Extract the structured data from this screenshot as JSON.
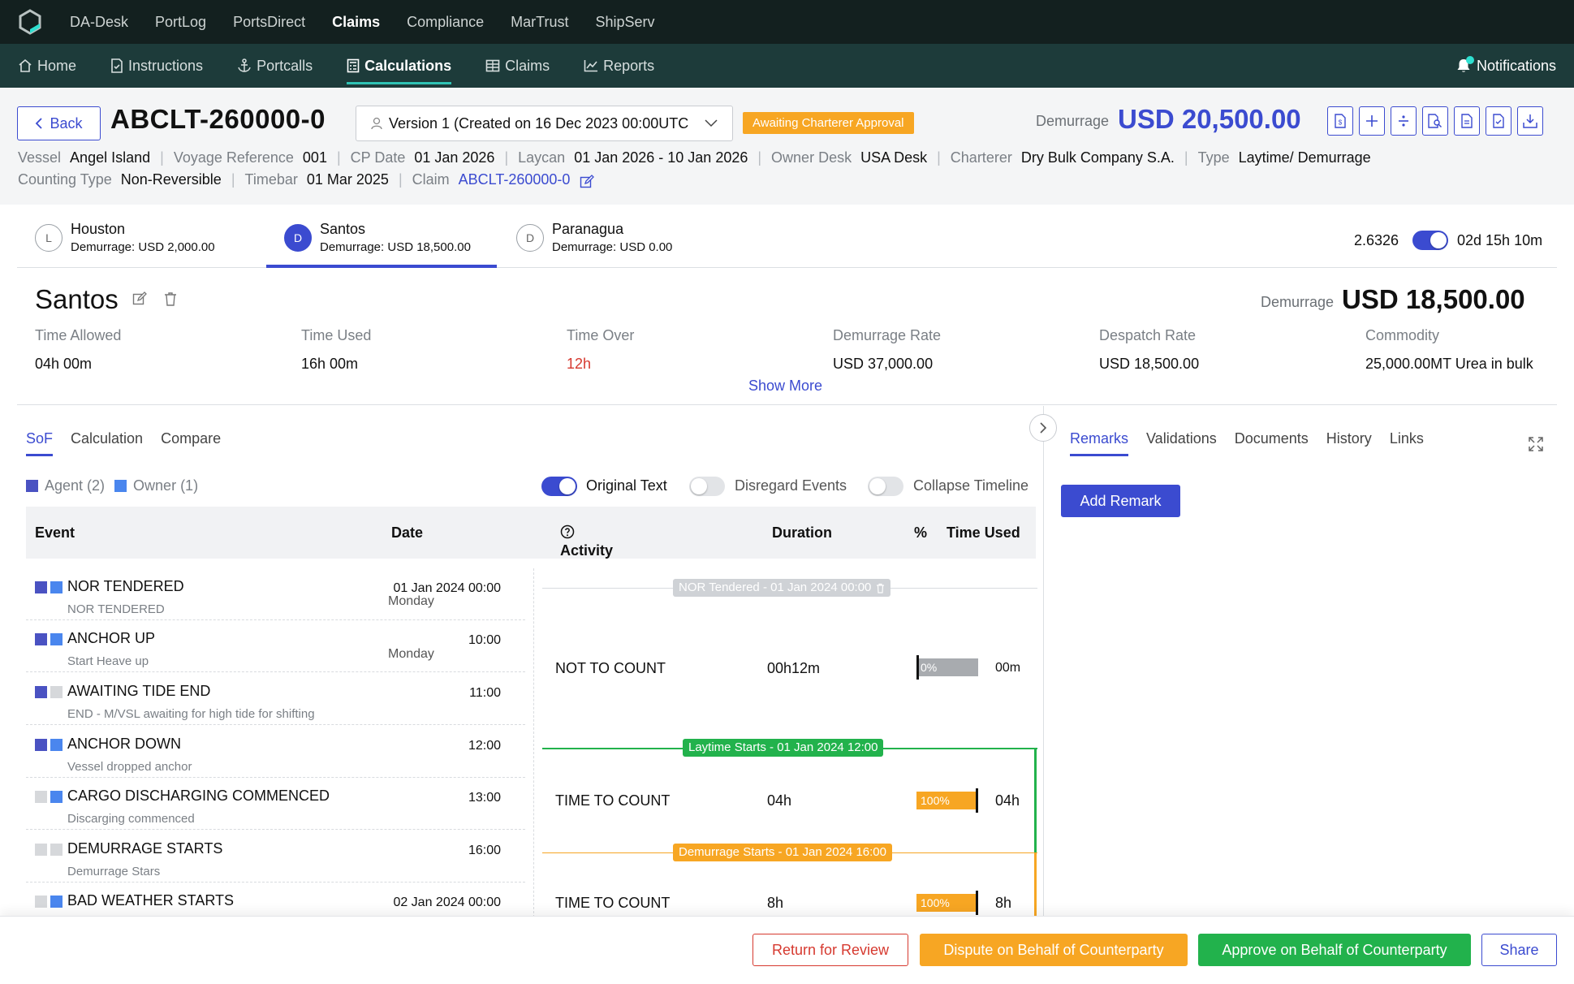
{
  "topnav": [
    "DA-Desk",
    "PortLog",
    "PortsDirect",
    "Claims",
    "Compliance",
    "MarTrust",
    "ShipServ"
  ],
  "topnav_active": "Claims",
  "subnav": {
    "home": "Home",
    "instructions": "Instructions",
    "portcalls": "Portcalls",
    "calculations": "Calculations",
    "claims": "Claims",
    "reports": "Reports",
    "notifications": "Notifications"
  },
  "header": {
    "back": "Back",
    "claim_id": "ABCLT-260000-0",
    "version": "Version 1 (Created on 16 Dec 2023 00:00UTC",
    "status_badge": "Awaiting Charterer Approval",
    "demurrage_label": "Demurrage",
    "demurrage_value": "USD 20,500.00"
  },
  "meta": {
    "vessel_k": "Vessel",
    "vessel_v": "Angel Island",
    "voyage_k": "Voyage Reference",
    "voyage_v": "001",
    "cpdate_k": "CP Date",
    "cpdate_v": "01 Jan 2026",
    "laycan_k": "Laycan",
    "laycan_v": "01 Jan 2026 - 10 Jan 2026",
    "ownerdesk_k": "Owner Desk",
    "ownerdesk_v": "USA Desk",
    "charterer_k": "Charterer",
    "charterer_v": "Dry Bulk Company S.A.",
    "type_k": "Type",
    "type_v": "Laytime/ Demurrage",
    "counting_k": "Counting Type",
    "counting_v": "Non-Reversible",
    "timebar_k": "Timebar",
    "timebar_v": "01 Mar 2025",
    "claim_k": "Claim",
    "claim_v": "ABCLT-260000-0"
  },
  "ports": [
    {
      "letter": "L",
      "name": "Houston",
      "demurrage": "Demurrage: USD 2,000.00"
    },
    {
      "letter": "D",
      "name": "Santos",
      "demurrage": "Demurrage: USD 18,500.00"
    },
    {
      "letter": "D",
      "name": "Paranagua",
      "demurrage": "Demurrage: USD 0.00"
    }
  ],
  "ratio": "2.6326",
  "total_duration": "02d 15h 10m",
  "port": {
    "title": "Santos",
    "demurrage_label": "Demurrage",
    "demurrage_value": "USD 18,500.00",
    "stats": [
      {
        "k": "Time Allowed",
        "v": "04h 00m"
      },
      {
        "k": "Time Used",
        "v": "16h 00m"
      },
      {
        "k": "Time Over",
        "v": "12h"
      },
      {
        "k": "Demurrage Rate",
        "v": "USD 37,000.00"
      },
      {
        "k": "Despatch Rate",
        "v": "USD 18,500.00"
      },
      {
        "k": "Commodity",
        "v": "25,000.00MT Urea in bulk"
      }
    ],
    "show_more": "Show More"
  },
  "left_tabs": [
    "SoF",
    "Calculation",
    "Compare"
  ],
  "legend": {
    "agent": "Agent (2)",
    "owner": "Owner (1)"
  },
  "toggles": {
    "original_text": "Original Text",
    "disregard": "Disregard Events",
    "collapse": "Collapse Timeline"
  },
  "table_head": {
    "event": "Event",
    "date": "Date",
    "activity": "Activity",
    "duration": "Duration",
    "pct": "%",
    "time_used": "Time Used"
  },
  "events": [
    {
      "name": "NOR TENDERED",
      "desc": "NOR TENDERED",
      "time": "01 Jan 2024 00:00",
      "weekday": "Monday",
      "agent": true,
      "owner": true
    },
    {
      "name": "ANCHOR UP",
      "desc": "Start Heave up",
      "time": "10:00",
      "weekday": "Monday",
      "agent": true,
      "owner": true
    },
    {
      "name": "AWAITING TIDE END",
      "desc": "END - M/VSL awaiting for high tide for shifting",
      "time": "11:00",
      "weekday": "",
      "agent": true,
      "owner": false
    },
    {
      "name": "ANCHOR DOWN",
      "desc": "Vessel dropped anchor",
      "time": "12:00",
      "weekday": "",
      "agent": true,
      "owner": true
    },
    {
      "name": "CARGO DISCHARGING COMMENCED",
      "desc": "Discarging commenced",
      "time": "13:00",
      "weekday": "",
      "agent": false,
      "owner": true
    },
    {
      "name": "DEMURRAGE STARTS",
      "desc": "Demurrage Stars",
      "time": "16:00",
      "weekday": "",
      "agent": false,
      "owner": false
    },
    {
      "name": "BAD WEATHER STARTS",
      "desc": "",
      "time": "02 Jan 2024 00:00",
      "weekday": "",
      "agent": false,
      "owner": true
    }
  ],
  "markers": {
    "nor": "NOR Tendered - 01 Jan 2024 00:00",
    "laytime": "Laytime Starts - 01 Jan 2024 12:00",
    "demurrage": "Demurrage Starts - 01 Jan 2024 16:00"
  },
  "activities": [
    {
      "activity": "NOT TO COUNT",
      "duration": "00h12m",
      "pct_label": "0%",
      "pct": 0,
      "time_used": "00m"
    },
    {
      "activity": "TIME TO COUNT",
      "duration": "04h",
      "pct_label": "100%",
      "pct": 100,
      "time_used": "04h"
    },
    {
      "activity": "TIME TO COUNT",
      "duration": "8h",
      "pct_label": "100%",
      "pct": 100,
      "time_used": "8h"
    }
  ],
  "right_tabs": [
    "Remarks",
    "Validations",
    "Documents",
    "History",
    "Links"
  ],
  "add_remark": "Add Remark",
  "footer": {
    "return": "Return for Review",
    "dispute": "Dispute on Behalf of Counterparty",
    "approve": "Approve on Behalf of Counterparty",
    "share": "Share"
  },
  "colors": {
    "primary": "#3b4bd0",
    "orange": "#f7a623",
    "green": "#22b24c",
    "red": "#d6392f",
    "topbar": "#13201f",
    "subbar": "#1d3b3a"
  }
}
